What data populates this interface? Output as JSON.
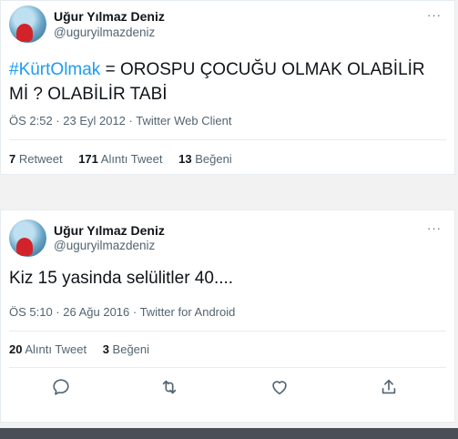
{
  "tweet1": {
    "display_name": "Uğur Yılmaz Deniz",
    "handle": "@uguryilmazdeniz",
    "more": "···",
    "hashtag": "#KürtOlmak",
    "text_rest": " = OROSPU ÇOCUĞU OLMAK OLABİLİR Mİ ? OLABİLİR TABİ",
    "timestamp": "ÖS 2:52 · 23 Eyl 2012 · Twitter Web Client",
    "stats": [
      {
        "count": "7",
        "label": "Retweet"
      },
      {
        "count": "171",
        "label": "Alıntı Tweet"
      },
      {
        "count": "13",
        "label": "Beğeni"
      }
    ]
  },
  "tweet2": {
    "display_name": "Uğur Yılmaz Deniz",
    "handle": "@uguryilmazdeniz",
    "more": "···",
    "text": "Kiz 15 yasinda selülitler 40....",
    "timestamp": "ÖS 5:10 · 26 Ağu 2016 · Twitter for Android",
    "stats": [
      {
        "count": "20",
        "label": "Alıntı Tweet"
      },
      {
        "count": "3",
        "label": "Beğeni"
      }
    ],
    "actions": [
      "reply-icon",
      "retweet-icon",
      "like-icon",
      "share-icon"
    ]
  }
}
